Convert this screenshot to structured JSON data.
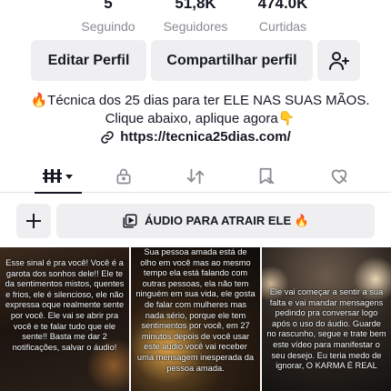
{
  "stats": [
    {
      "value": "5",
      "label": "Seguindo"
    },
    {
      "value": "51,8K",
      "label": "Seguidores"
    },
    {
      "value": "474.0K",
      "label": "Curtidas"
    }
  ],
  "actions": {
    "edit_label": "Editar Perfil",
    "share_label": "Compartilhar perfil"
  },
  "bio": {
    "text": "🔥Técnica dos 25 dias para ter ELE NAS SUAS MÃOS. Clique abaixo, aplique agora👇",
    "link": "https://tecnica25dias.com/"
  },
  "tabs": [
    {
      "icon": "grid-icon",
      "active": true
    },
    {
      "icon": "lock-icon",
      "active": false
    },
    {
      "icon": "repost-icon",
      "active": false
    },
    {
      "icon": "favorites-icon",
      "active": false
    },
    {
      "icon": "liked-icon",
      "active": false
    }
  ],
  "playlist": {
    "label": "ÁUDIO PARA ATRAIR ELE 🔥"
  },
  "videos": [
    {
      "caption": "Esse sinal é pra você! Você é a garota dos sonhos dele!! Ele te da sentimentos mistos, quentes e frios, ele é silencioso, ele não expressa oque realmente sente por você. Ele vai se abrir pra você e te falar tudo que ele sente!! Basta me dar 2 notificações, salvar o áudio!"
    },
    {
      "caption": "Sua pessoa amada está de olho em você mas ao mesmo tempo ela está falando com outras pessoas, ela não tem ninguém em sua vida, ele gosta de falar com mulheres mas nada sério, porque ele tem sentimentos por você, em 27 minutos depois de você usar este áudio você vai receber uma mensagem inesperada da pessoa amada."
    },
    {
      "caption": "Ele vai começar a sentir a sua falta e vai mandar mensagens pedindo pra conversar logo após o uso do áudio. Guarde no rascunho, segue e trate bem este vídeo para manifestar o seu desejo. Eu teria medo de ignorar, O KARMA É REAL"
    }
  ]
}
